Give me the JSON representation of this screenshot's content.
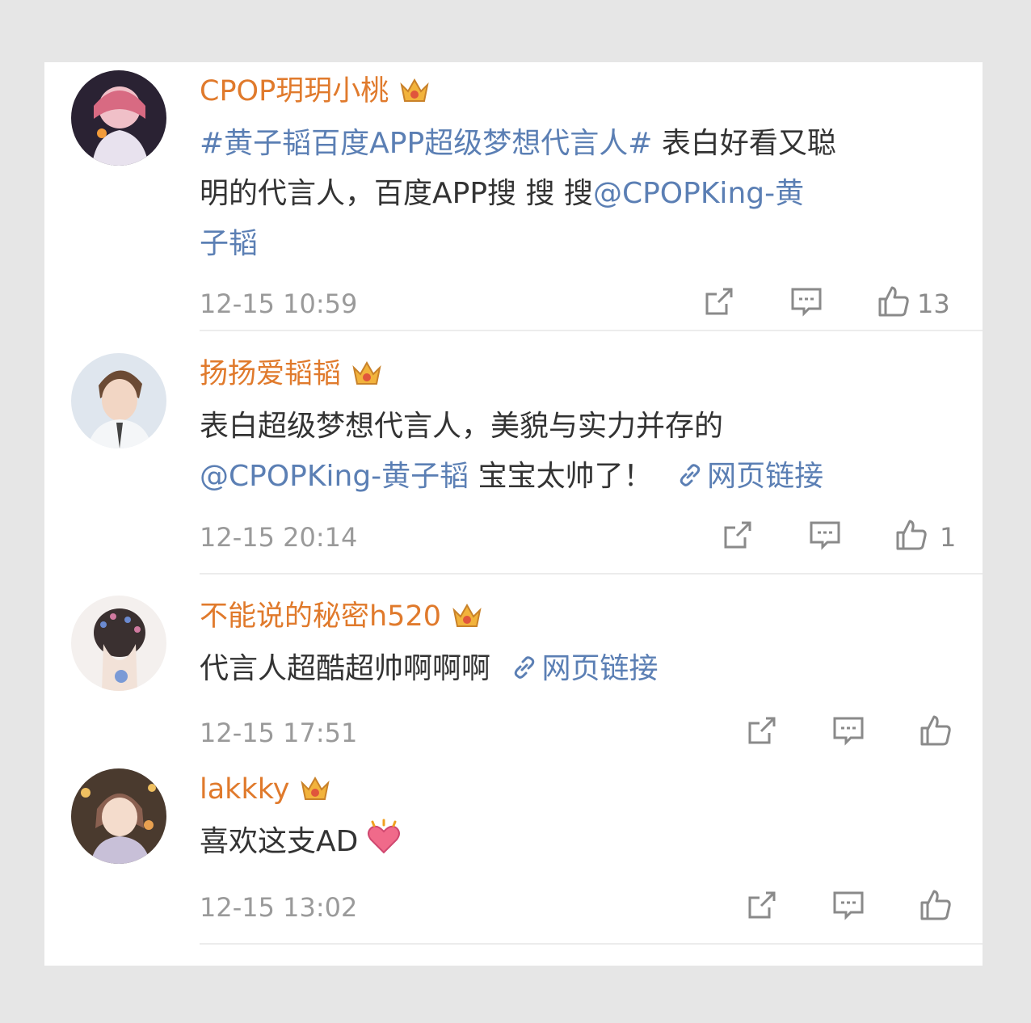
{
  "comments": [
    {
      "user": "CPOP玥玥小桃",
      "topic": "#黄子韬百度APP超级梦想代言人#",
      "text_line1_rest": " 表白好看又聪",
      "text_line2_plain": "明的代言人，百度APP搜  搜  搜",
      "mention_part1": "@CPOPKing-黄",
      "mention_part2": "子韬",
      "time": "12-15 10:59",
      "likes": "13"
    },
    {
      "user": "扬扬爱韬韬",
      "text_line1": "表白超级梦想代言人，美貌与实力并存的",
      "mention": "@CPOPKing-黄子韬",
      "text_after_mention": " 宝宝太帅了！",
      "link_label": "网页链接",
      "time": "12-15 20:14",
      "likes": "1"
    },
    {
      "user": "不能说的秘密h520",
      "text": "代言人超酷超帅啊啊啊",
      "link_label": "网页链接",
      "time": "12-15 17:51"
    },
    {
      "user": "lakkky",
      "text": "喜欢这支AD",
      "time": "12-15 13:02"
    }
  ],
  "colors": {
    "username": "#e07a2c",
    "link": "#5b7fb4",
    "text": "#333333",
    "meta": "#9a9a9a"
  },
  "icons": [
    "vip-crown-icon",
    "share-icon",
    "comment-icon",
    "like-icon",
    "link-icon",
    "heart-emoji-icon"
  ]
}
